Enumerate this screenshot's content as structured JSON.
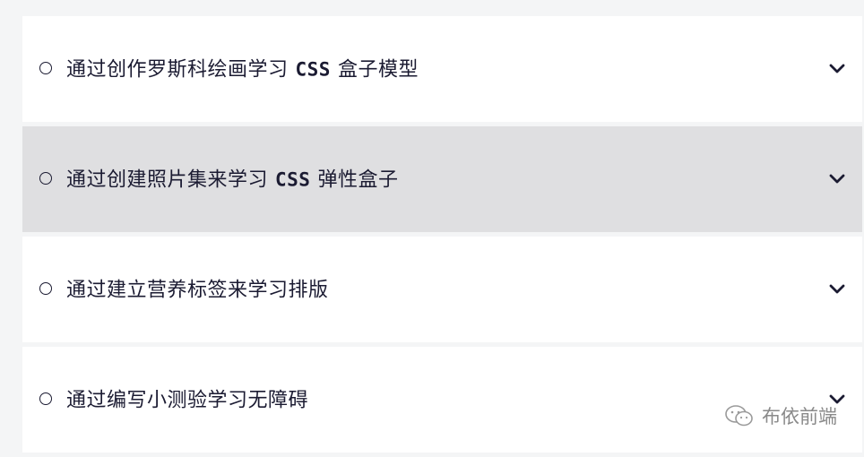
{
  "items": [
    {
      "pre": "通过创作罗斯科绘画学习",
      "code": "CSS",
      "post": "盒子模型"
    },
    {
      "pre": "通过创建照片集来学习",
      "code": "CSS",
      "post": "弹性盒子"
    },
    {
      "pre": "通过建立营养标签来学习排版",
      "code": "",
      "post": ""
    },
    {
      "pre": "通过编写小测验学习无障碍",
      "code": "",
      "post": ""
    }
  ],
  "watermark": {
    "text": "布依前端"
  }
}
